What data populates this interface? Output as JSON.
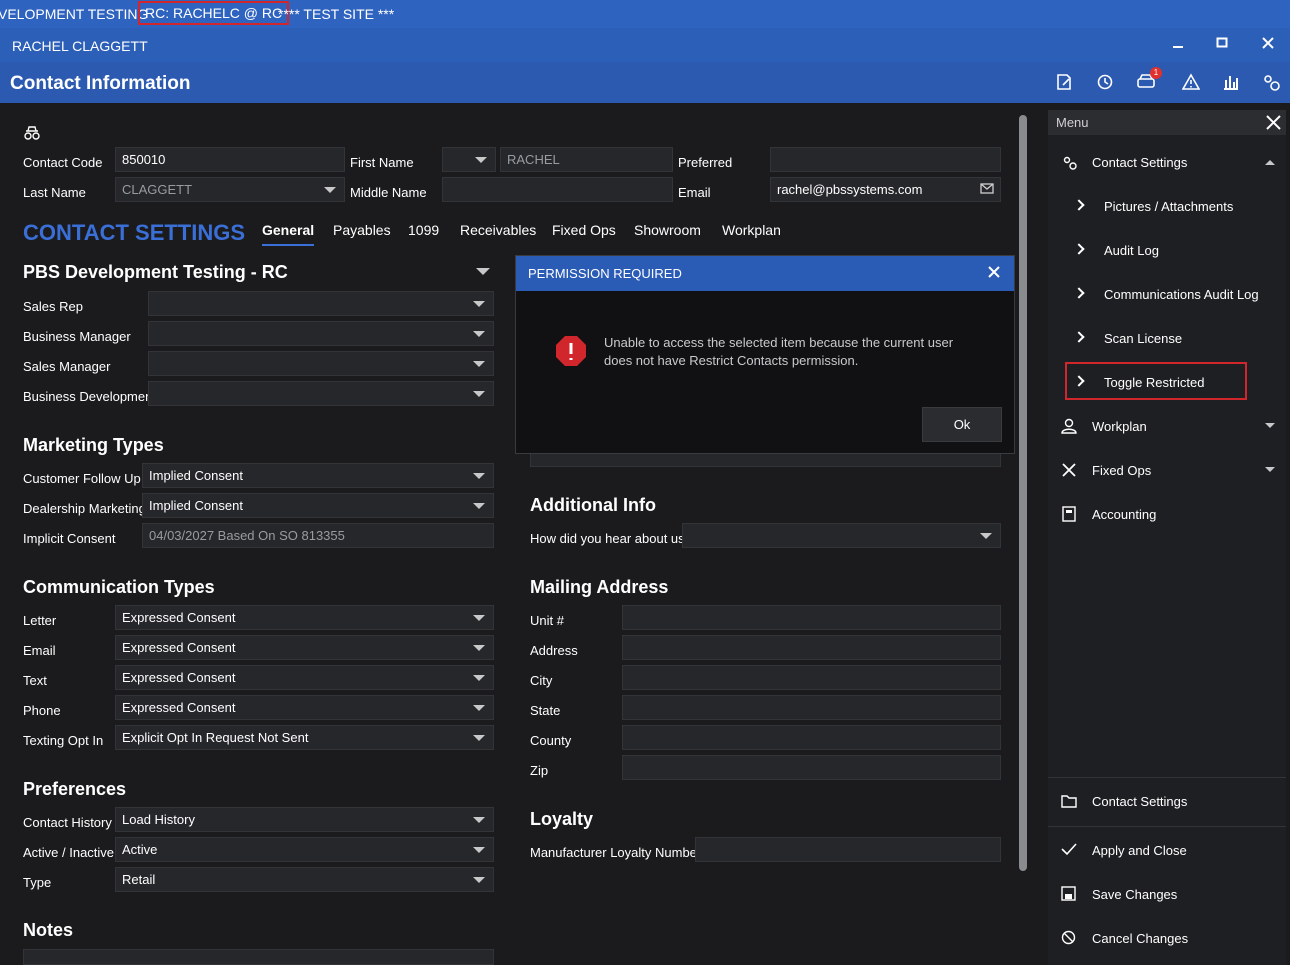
{
  "envbar": {
    "env_text": "VELOPMENT TESTING",
    "user": "RC: RACHELC @ RC",
    "test_site": "**** TEST SITE ***"
  },
  "window": {
    "user_name": "RACHEL CLAGGETT",
    "minimize": "—",
    "maximize": "◻",
    "close": "✕"
  },
  "header": {
    "title": "Contact Information",
    "notification_count": "1"
  },
  "contact": {
    "contact_code_label": "Contact Code",
    "contact_code": "850010",
    "last_name_label": "Last Name",
    "last_name": "CLAGGETT",
    "first_name_label": "First Name",
    "first_name": "RACHEL",
    "middle_name_label": "Middle Name",
    "middle_name": "",
    "preferred_label": "Preferred",
    "preferred": "",
    "email_label": "Email",
    "email": "rachel@pbssystems.com"
  },
  "settings": {
    "heading": "CONTACT SETTINGS",
    "tabs": [
      "General",
      "Payables",
      "1099",
      "Receivables",
      "Fixed Ops",
      "Showroom",
      "Workplan"
    ]
  },
  "dealership": {
    "title": "PBS Development Testing - RC",
    "rows": [
      {
        "label": "Sales Rep",
        "value": ""
      },
      {
        "label": "Business Manager",
        "value": ""
      },
      {
        "label": "Sales Manager",
        "value": ""
      },
      {
        "label": "Business Development",
        "value": ""
      }
    ]
  },
  "marketing": {
    "title": "Marketing Types",
    "rows": [
      {
        "label": "Customer Follow Up",
        "value": "Implied Consent"
      },
      {
        "label": "Dealership Marketing",
        "value": "Implied Consent"
      },
      {
        "label": "Implicit Consent",
        "value": "04/03/2027 Based On SO 813355"
      }
    ]
  },
  "communication": {
    "title": "Communication Types",
    "rows": [
      {
        "label": "Letter",
        "value": "Expressed Consent"
      },
      {
        "label": "Email",
        "value": "Expressed Consent"
      },
      {
        "label": "Text",
        "value": "Expressed Consent"
      },
      {
        "label": "Phone",
        "value": "Expressed Consent"
      },
      {
        "label": "Texting Opt In",
        "value": "Explicit Opt In Request Not Sent"
      }
    ]
  },
  "preferences": {
    "title": "Preferences",
    "rows": [
      {
        "label": "Contact History",
        "value": "Load History"
      },
      {
        "label": "Active / Inactive",
        "value": "Active"
      },
      {
        "label": "Type",
        "value": "Retail"
      }
    ]
  },
  "notes": {
    "title": "Notes"
  },
  "additional": {
    "title": "Additional Info",
    "hear_label": "How did you hear about us?",
    "hear_value": ""
  },
  "mailing": {
    "title": "Mailing Address",
    "rows": [
      {
        "label": "Unit #",
        "value": ""
      },
      {
        "label": "Address",
        "value": ""
      },
      {
        "label": "City",
        "value": ""
      },
      {
        "label": "State",
        "value": ""
      },
      {
        "label": "County",
        "value": ""
      },
      {
        "label": "Zip",
        "value": ""
      }
    ]
  },
  "loyalty": {
    "title": "Loyalty",
    "label": "Manufacturer Loyalty Number",
    "value": ""
  },
  "dialog": {
    "title": "PERMISSION REQUIRED",
    "message": "Unable to access the selected item because the current user does not have Restrict Contacts permission.",
    "ok": "Ok"
  },
  "menu": {
    "title": "Menu",
    "contact_settings": "Contact Settings",
    "sub_items": [
      "Pictures / Attachments",
      "Audit Log",
      "Communications Audit Log",
      "Scan License",
      "Toggle Restricted"
    ],
    "workplan": "Workplan",
    "fixed_ops": "Fixed Ops",
    "accounting": "Accounting",
    "footer": {
      "contact_settings": "Contact Settings",
      "apply_close": "Apply and Close",
      "save": "Save Changes",
      "cancel": "Cancel Changes"
    }
  },
  "colors": {
    "accent": "#2c5fb8",
    "heading_blue": "#3a6fd8",
    "alert_red": "#d0262c",
    "background": "#1b1b1d"
  },
  "icons": [
    "incognito-icon",
    "email-icon",
    "edit-icon",
    "history-icon",
    "car-icon",
    "warning-icon",
    "chart-icon",
    "settings-icon",
    "error-icon"
  ]
}
